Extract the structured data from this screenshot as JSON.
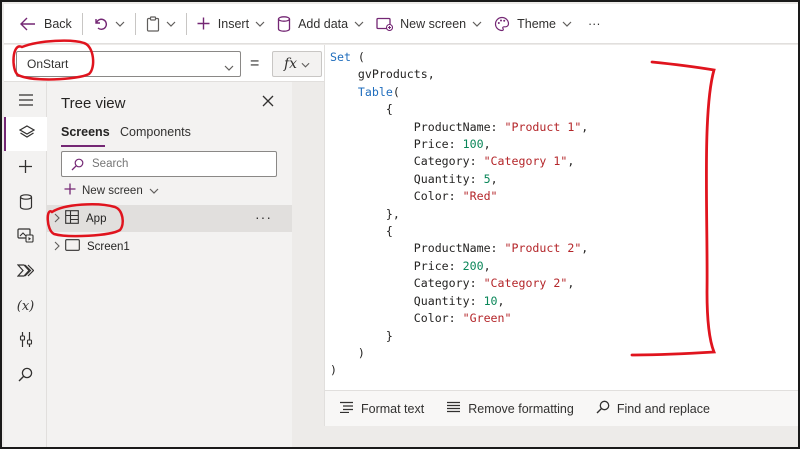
{
  "toolbar": {
    "back_label": "Back",
    "insert_label": "Insert",
    "add_data_label": "Add data",
    "new_screen_label": "New screen",
    "theme_label": "Theme",
    "more_label": "···"
  },
  "formula_bar": {
    "property": "OnStart",
    "equals": "=",
    "fx_label": "fx"
  },
  "tree_view": {
    "title": "Tree view",
    "tabs": [
      "Screens",
      "Components"
    ],
    "search_placeholder": "Search",
    "new_screen_label": "New screen",
    "items": [
      {
        "label": "App",
        "more": "···"
      },
      {
        "label": "Screen1"
      }
    ]
  },
  "code": {
    "kw_set": "Set",
    "open_paren": " (",
    "var_name": "gvProducts",
    "kw_table": "Table",
    "table_open": "(",
    "open_brace": "{",
    "close_brace": "}",
    "close_brace_comma": "},",
    "close_paren": ")",
    "comma": ",",
    "fields": {
      "product_name": "ProductName",
      "price": "Price",
      "category": "Category",
      "quantity": "Quantity",
      "color": "Color"
    },
    "records": [
      {
        "product_name": "\"Product 1\"",
        "price": "100",
        "category": "\"Category 1\"",
        "quantity": "5",
        "color": "\"Red\""
      },
      {
        "product_name": "\"Product 2\"",
        "price": "200",
        "category": "\"Category 2\"",
        "quantity": "10",
        "color": "\"Green\""
      }
    ]
  },
  "editor_footer": {
    "format_text": "Format text",
    "remove_formatting": "Remove formatting",
    "find_replace": "Find and replace"
  },
  "colors": {
    "accent": "#742774",
    "keyword": "#1f6dbd",
    "string": "#b4262a",
    "number": "#098658",
    "annotation": "#e0141e"
  }
}
